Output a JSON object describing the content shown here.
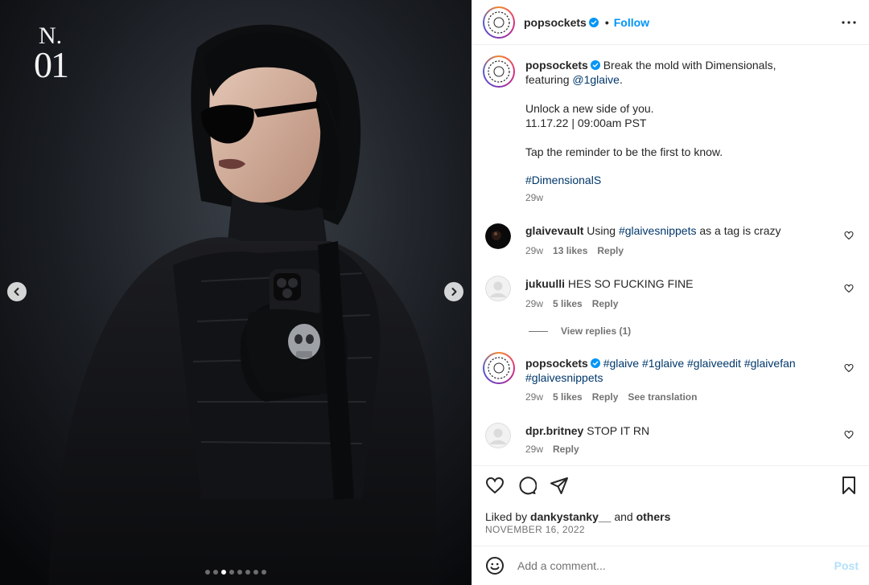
{
  "media": {
    "brand_mark_line1": "N.",
    "brand_mark_line2": "01",
    "dots_count": 8,
    "active_dot": 2
  },
  "header": {
    "username": "popsockets",
    "separator": "•",
    "follow_label": "Follow"
  },
  "caption": {
    "username": "popsockets",
    "line1": "Break the mold with Dimensionals,",
    "line2_prefix": "featuring ",
    "mention": "@1glaive",
    "line2_suffix": ".",
    "line3": "Unlock a new side of you.",
    "line4": "11.17.22 | 09:00am PST",
    "line5": "Tap the reminder to be the first to know.",
    "hashtag": "#DimensionalS",
    "time": "29w"
  },
  "comments": [
    {
      "username": "glaivevault",
      "text_before": "Using ",
      "hashtag": "#glaivesnippets",
      "text_after": " as a tag is crazy",
      "time": "29w",
      "likes": "13 likes",
      "reply": "Reply"
    },
    {
      "username": "jukuulli",
      "text": "HES SO FUCKING FINE",
      "time": "29w",
      "likes": "5 likes",
      "reply": "Reply",
      "view_replies": "View replies (1)"
    },
    {
      "username": "popsockets",
      "tags_line1": "#glaive #1glaive #glaiveedit #glaivefan",
      "tags_line2": "#glaivesnippets",
      "time": "29w",
      "likes": "5 likes",
      "reply": "Reply",
      "translation": "See translation"
    },
    {
      "username": "dpr.britney",
      "text": "STOP IT RN",
      "time": "29w",
      "reply": "Reply"
    }
  ],
  "footer": {
    "liked_prefix": "Liked by ",
    "liked_user": "dankystanky__",
    "liked_mid": " and ",
    "liked_others": "others",
    "date": "NOVEMBER 16, 2022",
    "comment_placeholder": "Add a comment...",
    "post_label": "Post"
  },
  "colors": {
    "link": "#00376b",
    "follow": "#0095f6",
    "muted": "#737373",
    "verified": "#0095f6"
  }
}
